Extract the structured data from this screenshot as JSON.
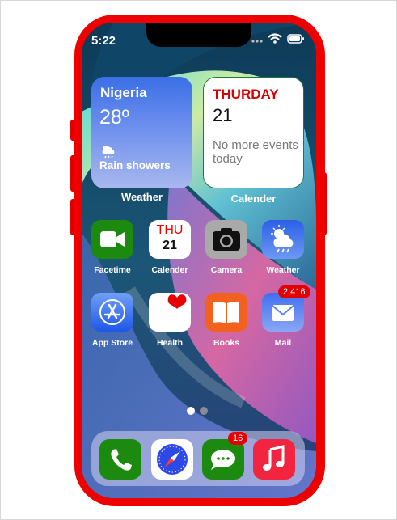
{
  "status_bar": {
    "time": "5:22"
  },
  "widgets": {
    "weather": {
      "city": "Nigeria",
      "temperature": "28º",
      "condition": "Rain showers",
      "label": "Weather",
      "icon": "cloud-sun-rain-icon"
    },
    "calendar": {
      "day": "THURDAY",
      "date": "21",
      "events": "No more events today",
      "label": "Calender"
    }
  },
  "apps": [
    {
      "label": "Facetime",
      "icon": "video-camera-icon",
      "color": "#1b8a0f"
    },
    {
      "label": "Calender",
      "icon": "calendar-icon",
      "day": "THU",
      "date": "21",
      "color": "#ffffff"
    },
    {
      "label": "Camera",
      "icon": "camera-icon",
      "color": "#a9a9a9"
    },
    {
      "label": "Weather",
      "icon": "cloud-sun-rain-icon",
      "color": "#2c5fe8"
    },
    {
      "label": "App Store",
      "icon": "app-store-icon",
      "color": "#2a69f0"
    },
    {
      "label": "Health",
      "icon": "heart-icon",
      "color": "#ffffff"
    },
    {
      "label": "Books",
      "icon": "book-icon",
      "color": "#f3611e"
    },
    {
      "label": "Mail",
      "icon": "envelope-icon",
      "badge": "2,416",
      "color": "#4a7cf0"
    }
  ],
  "page_dots": {
    "count": 2,
    "active": 1
  },
  "dock": [
    {
      "name": "phone",
      "icon": "phone-icon",
      "color": "#1b8a0f"
    },
    {
      "name": "safari",
      "icon": "compass-icon",
      "color": "#ffffff"
    },
    {
      "name": "messages",
      "icon": "message-icon",
      "badge": "16",
      "color": "#1b8a0f"
    },
    {
      "name": "music",
      "icon": "music-note-icon",
      "color": "#f2243f"
    }
  ],
  "colors": {
    "phone_frame": "#ee0000",
    "badge": "#e40000",
    "calendar_red": "#d80000"
  }
}
